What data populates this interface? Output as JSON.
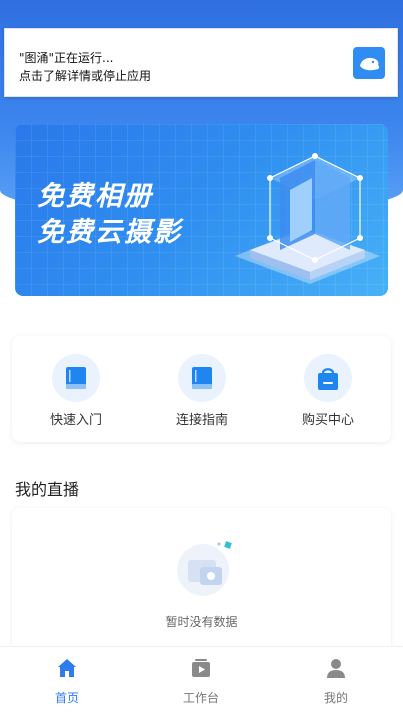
{
  "notification": {
    "title": "\"图涌\"正在运行...",
    "subtitle": "点击了解详情或停止应用",
    "icon": "app-logo-icon"
  },
  "banner": {
    "line1": "免费相册",
    "line2": "免费云摄影"
  },
  "menu": {
    "items": [
      {
        "label": "快速入门",
        "icon": "book-icon"
      },
      {
        "label": "连接指南",
        "icon": "book-icon"
      },
      {
        "label": "购买中心",
        "icon": "shopping-bag-icon"
      }
    ]
  },
  "live": {
    "title": "我的直播",
    "empty_text": "暂时没有数据",
    "empty_icon": "empty-photo-icon"
  },
  "tabbar": {
    "items": [
      {
        "label": "首页",
        "icon": "home-icon",
        "active": true
      },
      {
        "label": "工作台",
        "icon": "video-play-icon",
        "active": false
      },
      {
        "label": "我的",
        "icon": "user-icon",
        "active": false
      }
    ]
  },
  "colors": {
    "accent": "#2f7cf0",
    "header_blue": "#3d86ee",
    "inactive": "#777777"
  }
}
